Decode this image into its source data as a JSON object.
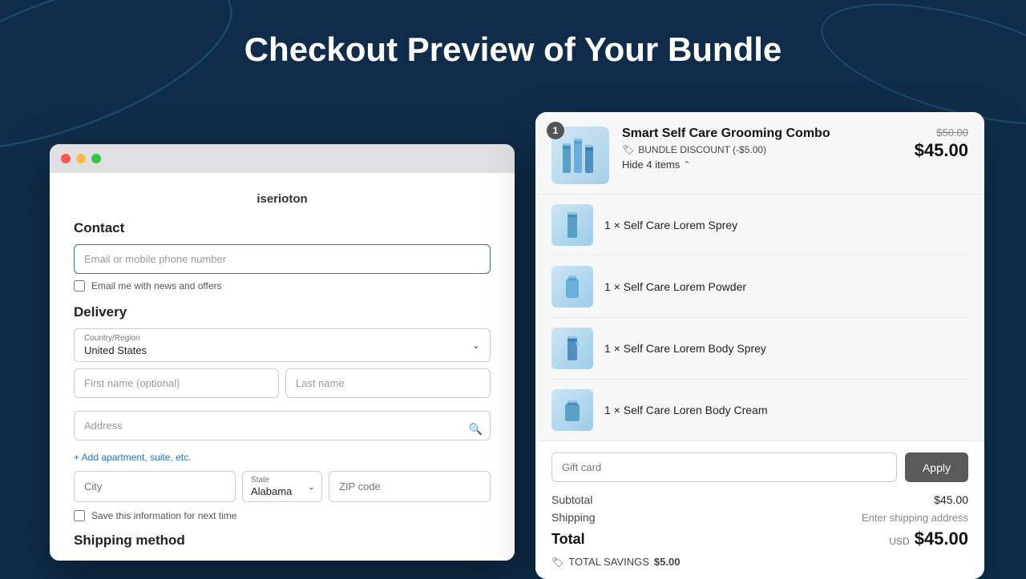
{
  "page": {
    "title": "Checkout Preview of Your Bundle",
    "background_color": "#0f2d4a"
  },
  "browser": {
    "store_name": "iserioton",
    "contact": {
      "section_label": "Contact",
      "email_placeholder": "Email or mobile phone number",
      "newsletter_label": "Email me with news and offers"
    },
    "delivery": {
      "section_label": "Delivery",
      "country_label": "Country/Region",
      "country_value": "United States",
      "first_name_placeholder": "First name (optional)",
      "last_name_placeholder": "Last name",
      "address_placeholder": "Address",
      "add_suite_label": "+ Add apartment, suite, etc.",
      "city_placeholder": "City",
      "state_label": "State",
      "state_value": "Alabama",
      "zip_placeholder": "ZIP code",
      "save_info_label": "Save this information for next time"
    },
    "shipping_method": {
      "section_label": "Shipping method"
    }
  },
  "order_summary": {
    "bundle": {
      "badge_count": "1",
      "name": "Smart Self Care Grooming Combo",
      "discount_label": "BUNDLE DISCOUNT (-$5.00)",
      "hide_items_label": "Hide 4 items",
      "original_price": "$50.00",
      "discounted_price": "$45.00"
    },
    "items": [
      {
        "name": "1 × Self Care Lorem Sprey"
      },
      {
        "name": "1 × Self Care Lorem Powder"
      },
      {
        "name": "1 × Self Care Lorem Body Sprey"
      },
      {
        "name": "1 × Self Care Loren Body Cream"
      }
    ],
    "gift_card": {
      "placeholder": "Gift card",
      "apply_label": "Apply"
    },
    "subtotal_label": "Subtotal",
    "subtotal_value": "$45.00",
    "shipping_label": "Shipping",
    "shipping_value": "Enter shipping address",
    "total_label": "Total",
    "total_currency": "USD",
    "total_amount": "$45.00",
    "savings_label": "TOTAL SAVINGS",
    "savings_amount": "$5.00"
  }
}
